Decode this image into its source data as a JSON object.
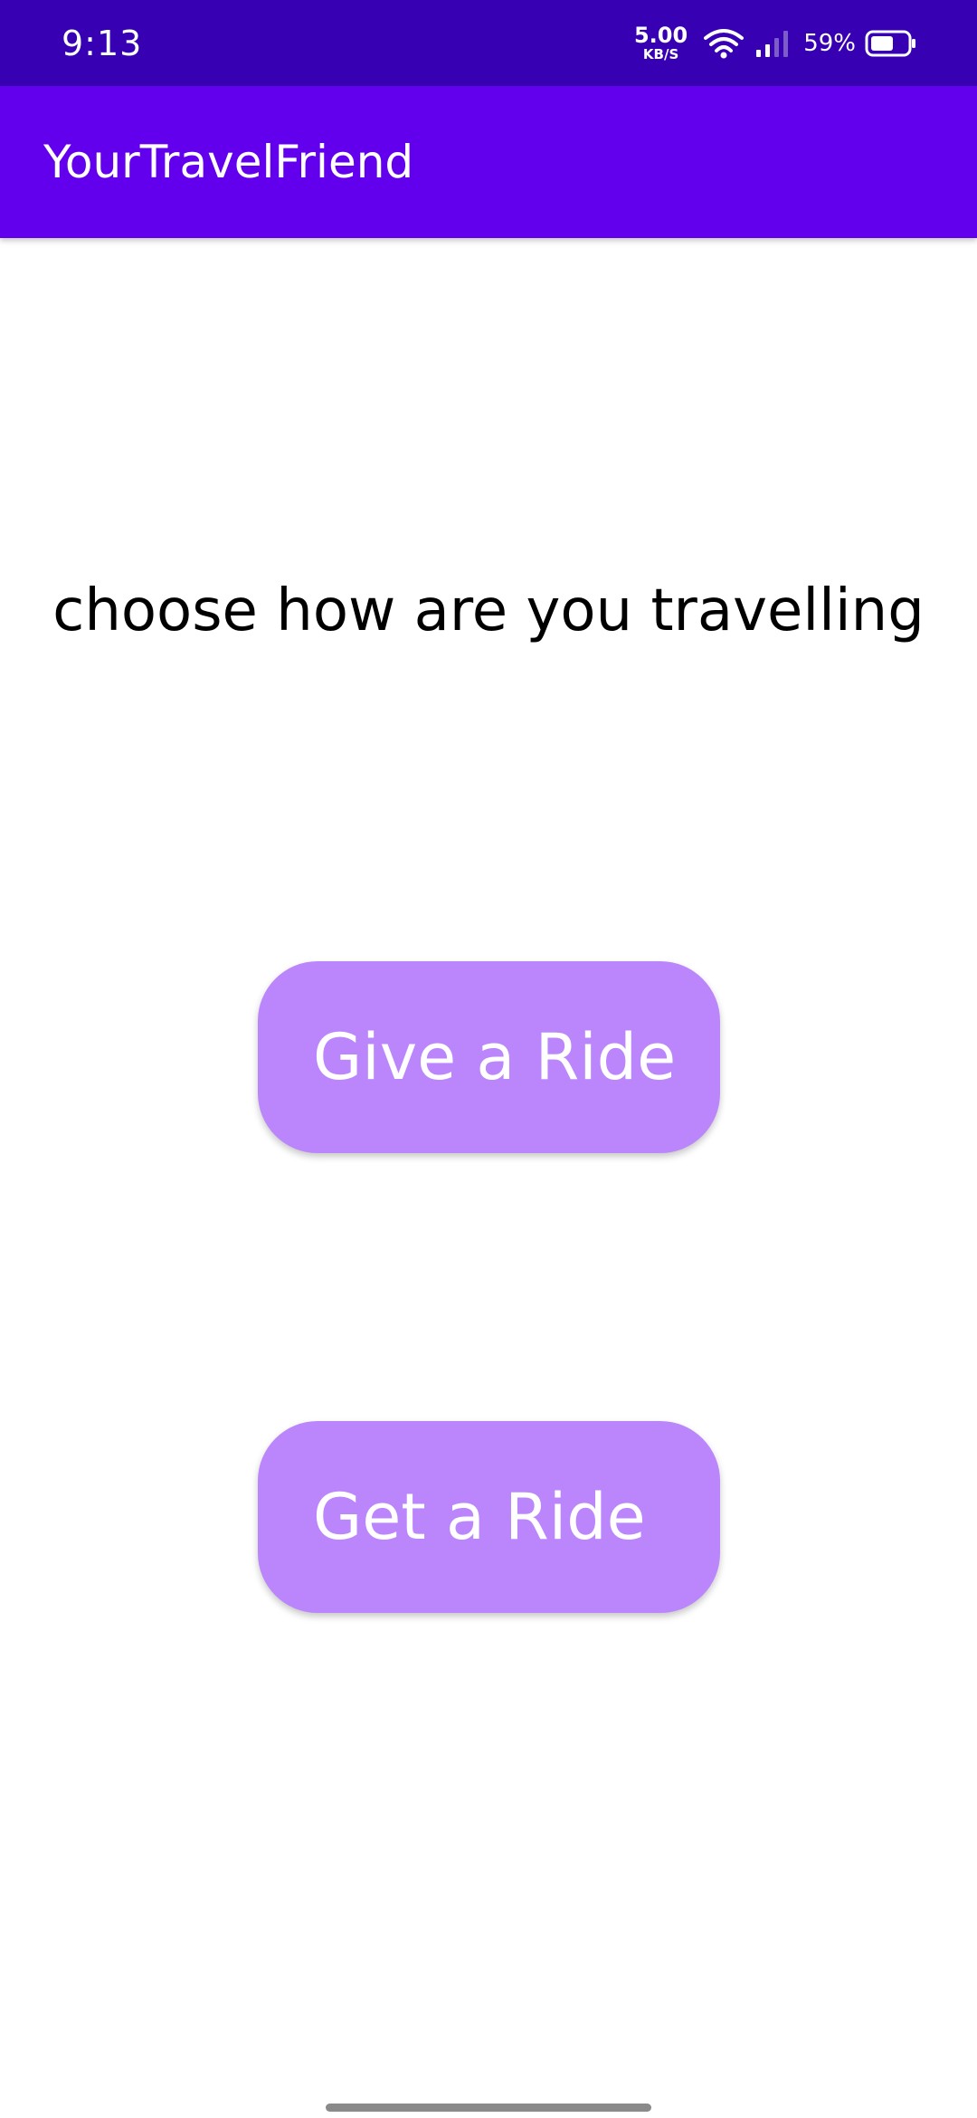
{
  "status_bar": {
    "time": "9:13",
    "net_speed_value": "5.00",
    "net_speed_unit": "KB/S",
    "battery_percent": "59%",
    "icons": [
      "wifi-icon",
      "signal-icon",
      "battery-icon"
    ],
    "background_color": "#3700B3"
  },
  "app_bar": {
    "title": "YourTravelFriend",
    "background_color": "#6200EE"
  },
  "main": {
    "prompt": "choose how are you travelling",
    "give_ride_label": "Give a Ride",
    "get_ride_label": "Get a Ride",
    "button_color": "#BB86FC"
  }
}
